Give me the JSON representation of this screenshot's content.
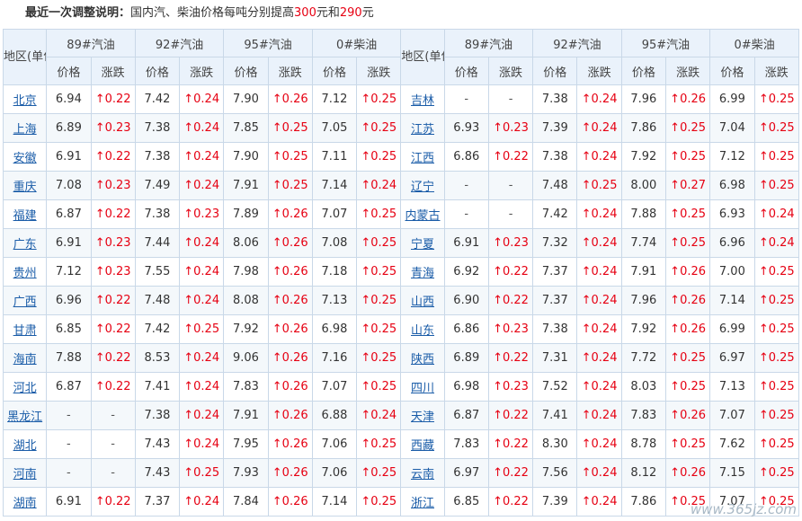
{
  "header": {
    "label": "最近一次调整说明：",
    "text_before": "国内汽、柴油价格每吨分别提高",
    "gas_increase": "300",
    "mid": "元和",
    "diesel_increase": "290",
    "suffix": "元"
  },
  "columns": {
    "region": "地区(单位:元/升)",
    "fuels": [
      "89#汽油",
      "92#汽油",
      "95#汽油",
      "0#柴油"
    ],
    "price": "价格",
    "change": "涨跌"
  },
  "rows": [
    [
      {
        "name": "北京",
        "v": [
          [
            "6.94",
            "↑0.22"
          ],
          [
            "7.42",
            "↑0.24"
          ],
          [
            "7.90",
            "↑0.26"
          ],
          [
            "7.12",
            "↑0.25"
          ]
        ]
      },
      {
        "name": "吉林",
        "v": [
          [
            "-",
            "-"
          ],
          [
            "7.38",
            "↑0.24"
          ],
          [
            "7.96",
            "↑0.26"
          ],
          [
            "6.99",
            "↑0.25"
          ]
        ]
      }
    ],
    [
      {
        "name": "上海",
        "v": [
          [
            "6.89",
            "↑0.23"
          ],
          [
            "7.38",
            "↑0.24"
          ],
          [
            "7.85",
            "↑0.25"
          ],
          [
            "7.05",
            "↑0.25"
          ]
        ]
      },
      {
        "name": "江苏",
        "v": [
          [
            "6.93",
            "↑0.23"
          ],
          [
            "7.39",
            "↑0.24"
          ],
          [
            "7.86",
            "↑0.25"
          ],
          [
            "7.04",
            "↑0.25"
          ]
        ]
      }
    ],
    [
      {
        "name": "安徽",
        "v": [
          [
            "6.91",
            "↑0.22"
          ],
          [
            "7.38",
            "↑0.24"
          ],
          [
            "7.90",
            "↑0.25"
          ],
          [
            "7.11",
            "↑0.25"
          ]
        ]
      },
      {
        "name": "江西",
        "v": [
          [
            "6.86",
            "↑0.22"
          ],
          [
            "7.38",
            "↑0.24"
          ],
          [
            "7.92",
            "↑0.25"
          ],
          [
            "7.12",
            "↑0.25"
          ]
        ]
      }
    ],
    [
      {
        "name": "重庆",
        "v": [
          [
            "7.08",
            "↑0.23"
          ],
          [
            "7.49",
            "↑0.24"
          ],
          [
            "7.91",
            "↑0.25"
          ],
          [
            "7.14",
            "↑0.24"
          ]
        ]
      },
      {
        "name": "辽宁",
        "v": [
          [
            "-",
            "-"
          ],
          [
            "7.48",
            "↑0.25"
          ],
          [
            "8.00",
            "↑0.27"
          ],
          [
            "6.98",
            "↑0.25"
          ]
        ]
      }
    ],
    [
      {
        "name": "福建",
        "v": [
          [
            "6.87",
            "↑0.22"
          ],
          [
            "7.38",
            "↑0.23"
          ],
          [
            "7.89",
            "↑0.26"
          ],
          [
            "7.07",
            "↑0.25"
          ]
        ]
      },
      {
        "name": "内蒙古",
        "v": [
          [
            "-",
            "-"
          ],
          [
            "7.42",
            "↑0.24"
          ],
          [
            "7.88",
            "↑0.25"
          ],
          [
            "6.93",
            "↑0.24"
          ]
        ]
      }
    ],
    [
      {
        "name": "广东",
        "v": [
          [
            "6.91",
            "↑0.23"
          ],
          [
            "7.44",
            "↑0.24"
          ],
          [
            "8.06",
            "↑0.26"
          ],
          [
            "7.08",
            "↑0.25"
          ]
        ]
      },
      {
        "name": "宁夏",
        "v": [
          [
            "6.91",
            "↑0.23"
          ],
          [
            "7.32",
            "↑0.24"
          ],
          [
            "7.74",
            "↑0.25"
          ],
          [
            "6.96",
            "↑0.24"
          ]
        ]
      }
    ],
    [
      {
        "name": "贵州",
        "v": [
          [
            "7.12",
            "↑0.23"
          ],
          [
            "7.55",
            "↑0.24"
          ],
          [
            "7.98",
            "↑0.26"
          ],
          [
            "7.18",
            "↑0.25"
          ]
        ]
      },
      {
        "name": "青海",
        "v": [
          [
            "6.92",
            "↑0.22"
          ],
          [
            "7.37",
            "↑0.24"
          ],
          [
            "7.91",
            "↑0.26"
          ],
          [
            "7.00",
            "↑0.25"
          ]
        ]
      }
    ],
    [
      {
        "name": "广西",
        "v": [
          [
            "6.96",
            "↑0.22"
          ],
          [
            "7.48",
            "↑0.24"
          ],
          [
            "8.08",
            "↑0.26"
          ],
          [
            "7.13",
            "↑0.25"
          ]
        ]
      },
      {
        "name": "山西",
        "v": [
          [
            "6.90",
            "↑0.22"
          ],
          [
            "7.37",
            "↑0.24"
          ],
          [
            "7.96",
            "↑0.26"
          ],
          [
            "7.14",
            "↑0.25"
          ]
        ]
      }
    ],
    [
      {
        "name": "甘肃",
        "v": [
          [
            "6.85",
            "↑0.22"
          ],
          [
            "7.42",
            "↑0.25"
          ],
          [
            "7.92",
            "↑0.26"
          ],
          [
            "6.98",
            "↑0.25"
          ]
        ]
      },
      {
        "name": "山东",
        "v": [
          [
            "6.86",
            "↑0.23"
          ],
          [
            "7.38",
            "↑0.24"
          ],
          [
            "7.92",
            "↑0.26"
          ],
          [
            "6.99",
            "↑0.25"
          ]
        ]
      }
    ],
    [
      {
        "name": "海南",
        "v": [
          [
            "7.88",
            "↑0.22"
          ],
          [
            "8.53",
            "↑0.24"
          ],
          [
            "9.06",
            "↑0.26"
          ],
          [
            "7.16",
            "↑0.25"
          ]
        ]
      },
      {
        "name": "陕西",
        "v": [
          [
            "6.89",
            "↑0.22"
          ],
          [
            "7.31",
            "↑0.24"
          ],
          [
            "7.72",
            "↑0.25"
          ],
          [
            "6.97",
            "↑0.25"
          ]
        ]
      }
    ],
    [
      {
        "name": "河北",
        "v": [
          [
            "6.87",
            "↑0.22"
          ],
          [
            "7.41",
            "↑0.24"
          ],
          [
            "7.83",
            "↑0.26"
          ],
          [
            "7.07",
            "↑0.25"
          ]
        ]
      },
      {
        "name": "四川",
        "v": [
          [
            "6.98",
            "↑0.23"
          ],
          [
            "7.52",
            "↑0.24"
          ],
          [
            "8.03",
            "↑0.25"
          ],
          [
            "7.13",
            "↑0.25"
          ]
        ]
      }
    ],
    [
      {
        "name": "黑龙江",
        "v": [
          [
            "-",
            "-"
          ],
          [
            "7.38",
            "↑0.24"
          ],
          [
            "7.91",
            "↑0.26"
          ],
          [
            "6.88",
            "↑0.24"
          ]
        ]
      },
      {
        "name": "天津",
        "v": [
          [
            "6.87",
            "↑0.22"
          ],
          [
            "7.41",
            "↑0.24"
          ],
          [
            "7.83",
            "↑0.26"
          ],
          [
            "7.07",
            "↑0.25"
          ]
        ]
      }
    ],
    [
      {
        "name": "湖北",
        "v": [
          [
            "-",
            "-"
          ],
          [
            "7.43",
            "↑0.24"
          ],
          [
            "7.95",
            "↑0.26"
          ],
          [
            "7.06",
            "↑0.25"
          ]
        ]
      },
      {
        "name": "西藏",
        "v": [
          [
            "7.83",
            "↑0.22"
          ],
          [
            "8.30",
            "↑0.24"
          ],
          [
            "8.78",
            "↑0.25"
          ],
          [
            "7.62",
            "↑0.25"
          ]
        ]
      }
    ],
    [
      {
        "name": "河南",
        "v": [
          [
            "-",
            "-"
          ],
          [
            "7.43",
            "↑0.25"
          ],
          [
            "7.93",
            "↑0.26"
          ],
          [
            "7.06",
            "↑0.25"
          ]
        ]
      },
      {
        "name": "云南",
        "v": [
          [
            "6.97",
            "↑0.22"
          ],
          [
            "7.56",
            "↑0.24"
          ],
          [
            "8.12",
            "↑0.26"
          ],
          [
            "7.15",
            "↑0.25"
          ]
        ]
      }
    ],
    [
      {
        "name": "湖南",
        "v": [
          [
            "6.91",
            "↑0.22"
          ],
          [
            "7.37",
            "↑0.24"
          ],
          [
            "7.84",
            "↑0.26"
          ],
          [
            "7.14",
            "↑0.25"
          ]
        ]
      },
      {
        "name": "浙江",
        "v": [
          [
            "6.85",
            "↑0.22"
          ],
          [
            "7.39",
            "↑0.24"
          ],
          [
            "7.86",
            "↑0.25"
          ],
          [
            "7.07",
            "↑0.25"
          ]
        ]
      }
    ]
  ],
  "watermark": "www.365jz.com"
}
